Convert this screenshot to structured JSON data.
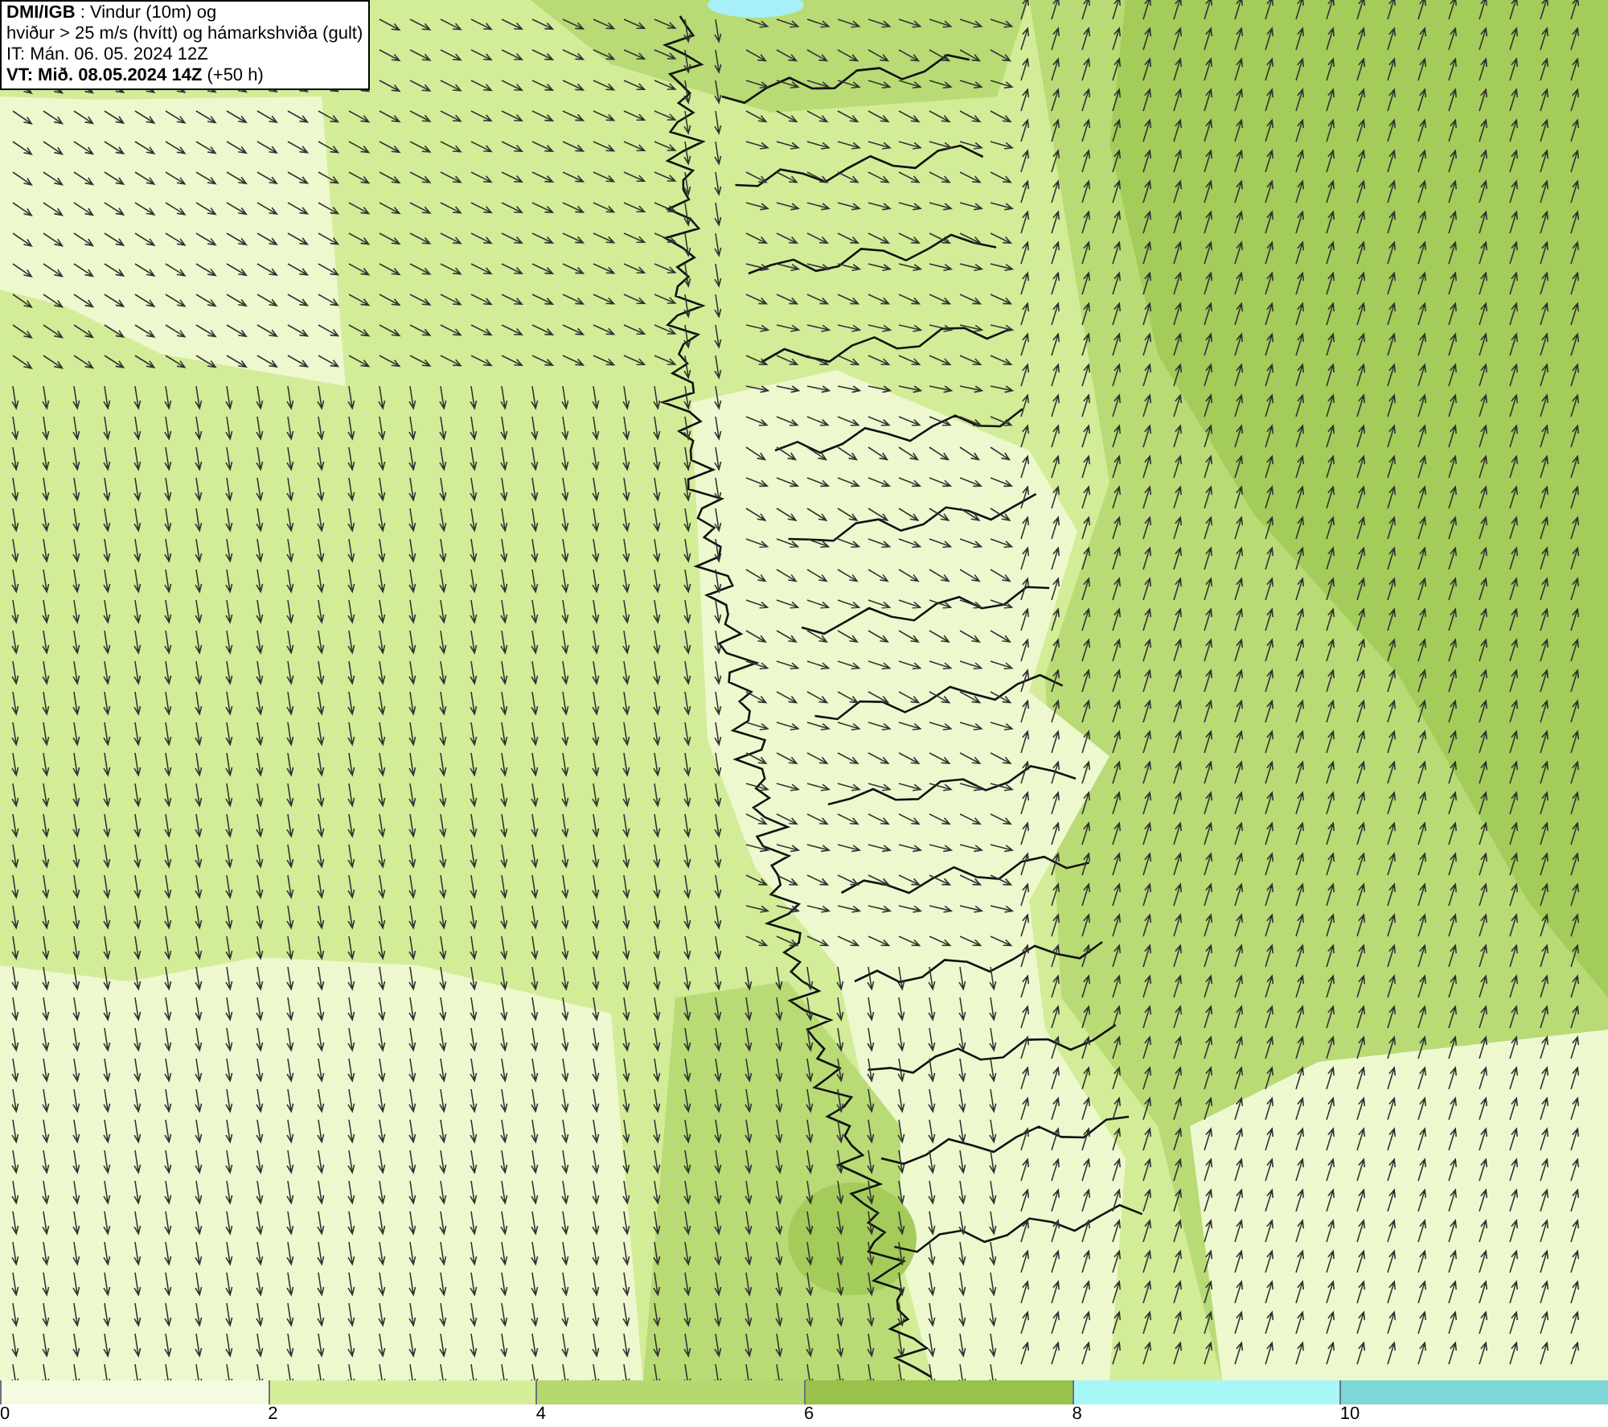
{
  "title_box": {
    "lines": [
      "**DMI/IGB** : Vindur (10m) og",
      "hviður > 25 m/s (hvítt) og hámarkshviða (gult)",
      "IT: Mán. 06. 05. 2024 12Z",
      "**VT: Mið. 08.05.2024 14Z** (+50 h)"
    ]
  },
  "legend": {
    "segments": [
      {
        "label": "0",
        "color": "#f4fbe0"
      },
      {
        "label": "2",
        "color": "#d6ee9a"
      },
      {
        "label": "4",
        "color": "#b5d970"
      },
      {
        "label": "6",
        "color": "#98c24a"
      },
      {
        "label": "8",
        "color": "#a8f7f7"
      },
      {
        "label": "10",
        "color": "#7ed7d8"
      }
    ]
  }
}
